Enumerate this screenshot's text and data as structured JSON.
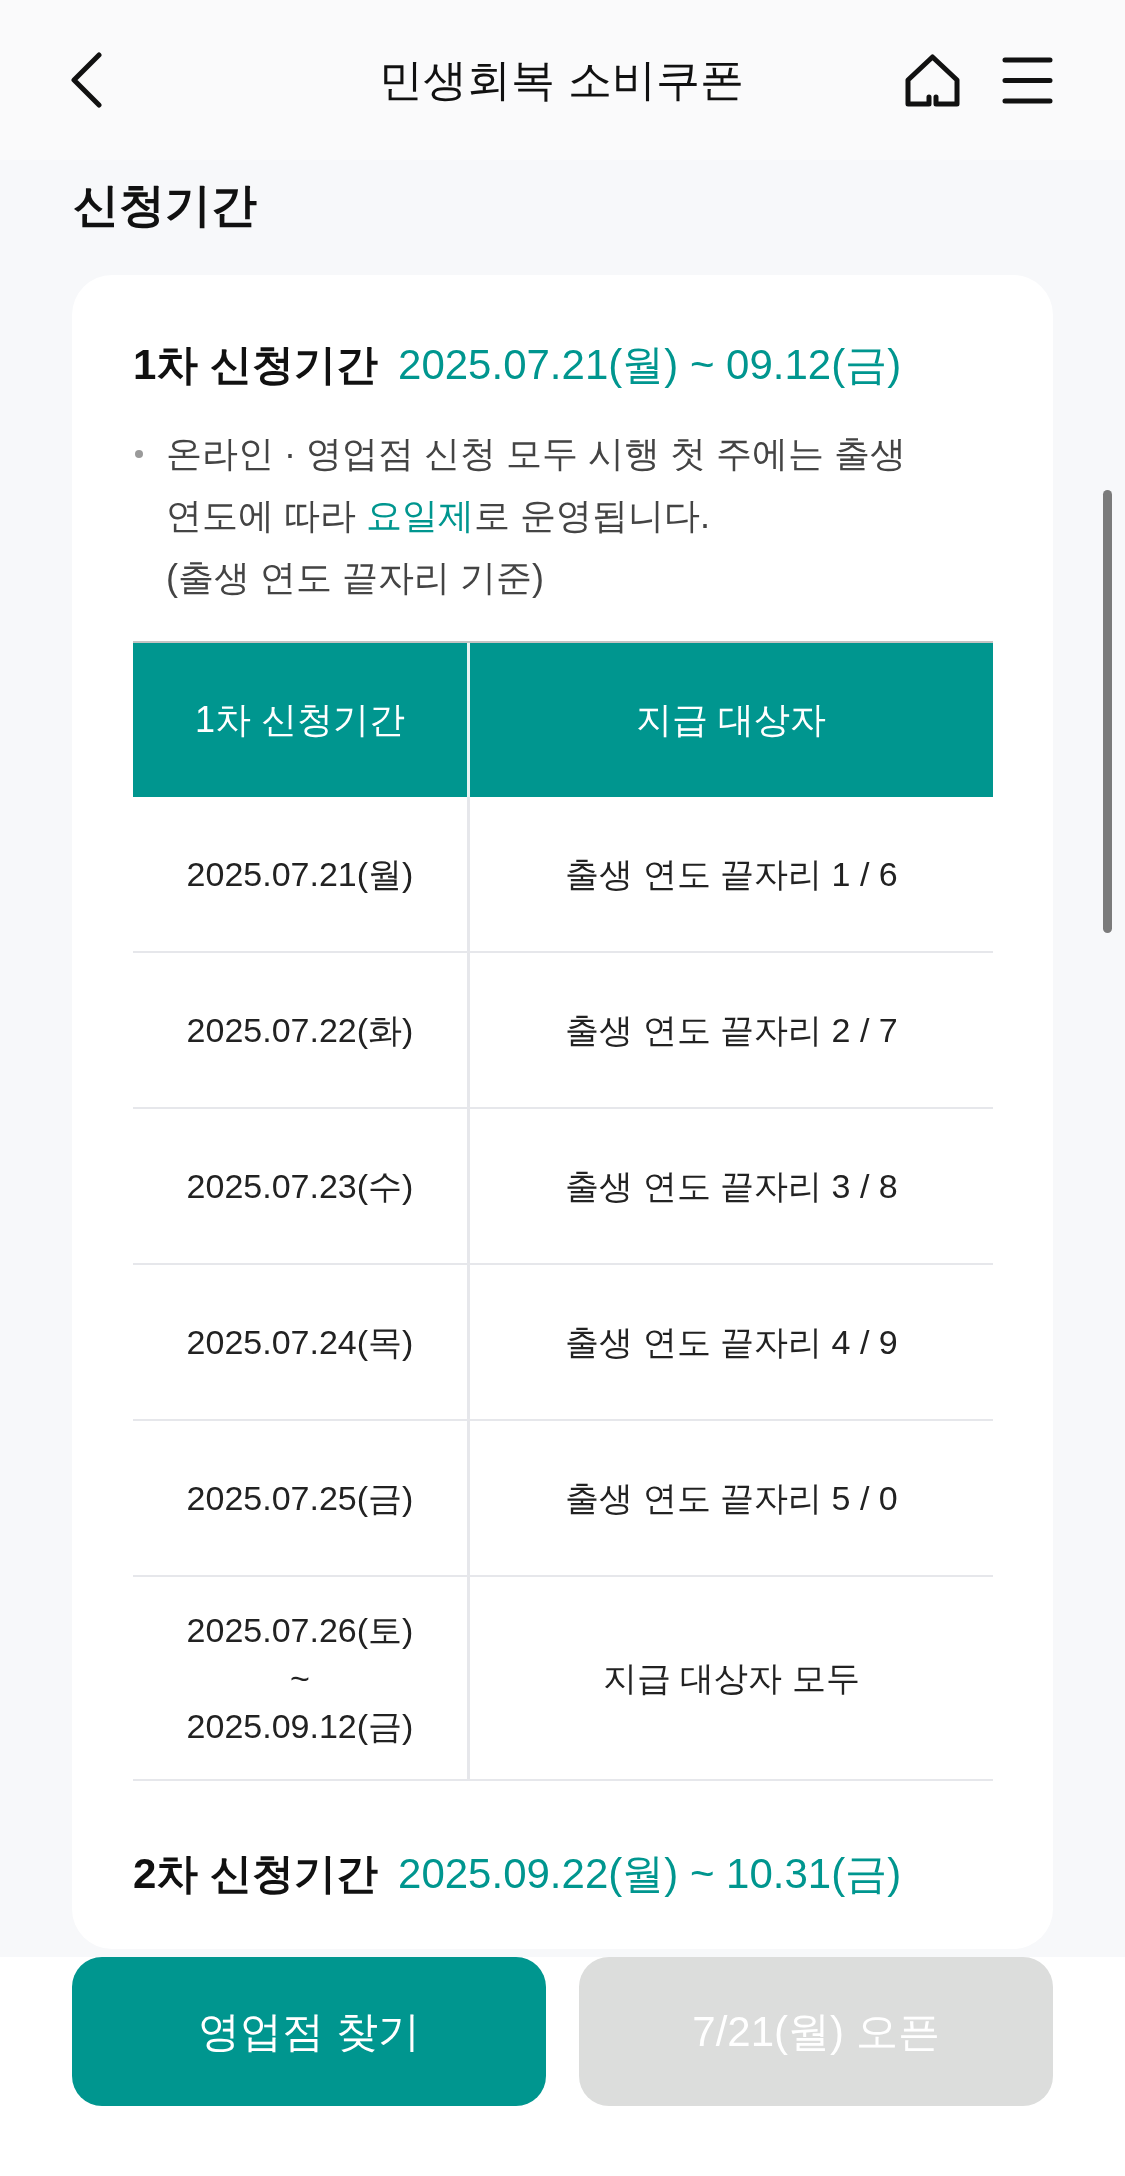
{
  "header": {
    "title": "민생회복 소비쿠폰"
  },
  "section_title": "신청기간",
  "periods": [
    {
      "label": "1차 신청기간",
      "dates": "2025.07.21(월) ~ 09.12(금)",
      "notes": [
        {
          "parts": [
            {
              "text": "온라인 · 영업점 신청 모두 시행 첫 주에는 출생 연도에 따라 ",
              "highlight": false
            },
            {
              "text": "요일제",
              "highlight": true
            },
            {
              "text": "로 운영됩니다.",
              "highlight": false
            }
          ],
          "remark": "(출생 연도 끝자리 기준)"
        }
      ],
      "table": {
        "columns": [
          "1차 신청기간",
          "지급 대상자"
        ],
        "rows": [
          {
            "period": [
              "2025.07.21(월)"
            ],
            "eligible": "출생 연도 끝자리 1 / 6"
          },
          {
            "period": [
              "2025.07.22(화)"
            ],
            "eligible": "출생 연도 끝자리 2 / 7"
          },
          {
            "period": [
              "2025.07.23(수)"
            ],
            "eligible": "출생 연도 끝자리 3 / 8"
          },
          {
            "period": [
              "2025.07.24(목)"
            ],
            "eligible": "출생 연도 끝자리 4 / 9"
          },
          {
            "period": [
              "2025.07.25(금)"
            ],
            "eligible": "출생 연도 끝자리 5 / 0"
          },
          {
            "period": [
              "2025.07.26(토)",
              "~",
              "2025.09.12(금)"
            ],
            "eligible": "지급 대상자 모두"
          }
        ]
      }
    },
    {
      "label": "2차 신청기간",
      "dates": "2025.09.22(월) ~ 10.31(금)"
    }
  ],
  "buttons": [
    {
      "label": "영업점 찾기",
      "disabled": false
    },
    {
      "label": "7/21(월) 오픈",
      "disabled": true
    }
  ]
}
